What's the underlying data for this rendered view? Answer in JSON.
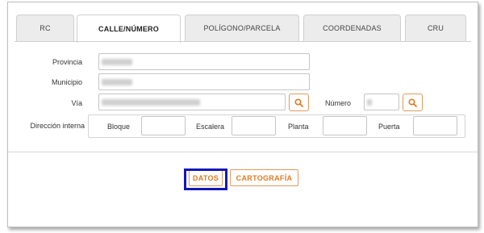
{
  "tabs": {
    "rc": "RC",
    "calle": "CALLE/NÚMERO",
    "poligono": "POLÍGONO/PARCELA",
    "coordenadas": "COORDENADAS",
    "cru": "CRU"
  },
  "form": {
    "provincia_label": "Provincia",
    "municipio_label": "Municipio",
    "via_label": "Vía",
    "numero_label": "Número",
    "direccion_label": "Dirección interna",
    "bloque_label": "Bloque",
    "escalera_label": "Escalera",
    "planta_label": "Planta",
    "puerta_label": "Puerta"
  },
  "buttons": {
    "datos": "DATOS",
    "cartografia": "CARTOGRAFÍA"
  },
  "colors": {
    "accent": "#e07a24",
    "highlight": "#1218b8"
  },
  "icons": {
    "search": "search-icon"
  }
}
